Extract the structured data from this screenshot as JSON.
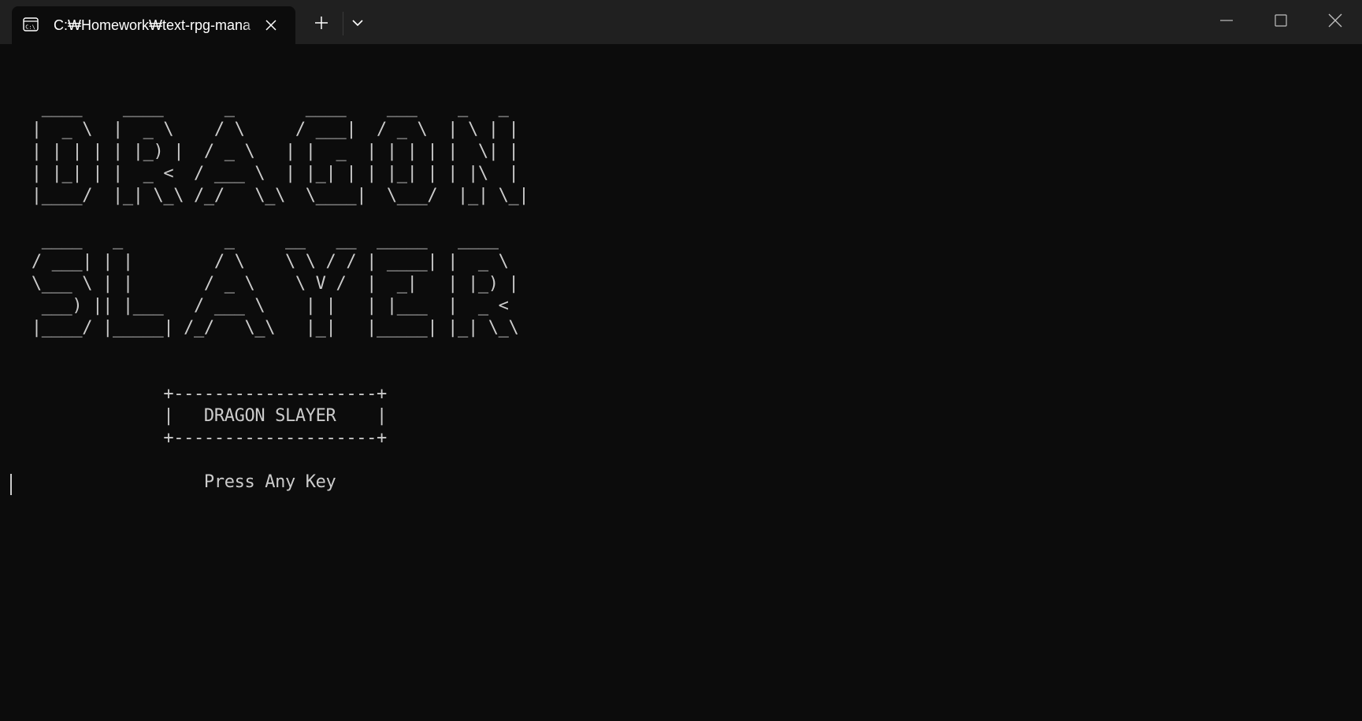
{
  "tab": {
    "title": "C:₩Homework₩text-rpg-mana",
    "icon": "command-prompt-icon"
  },
  "titlebar": {
    "new_tab_icon": "plus-icon",
    "dropdown_icon": "chevron-down-icon",
    "minimize_icon": "minimize-icon",
    "maximize_icon": "maximize-icon",
    "close_icon": "close-icon"
  },
  "terminal": {
    "background": "#0c0c0c",
    "foreground": "#cccccc",
    "lines": [
      "",
      "  ____    ____      _       ____    ___    _   _",
      " |  _ \\  |  _ \\    / \\     / ___|  / _ \\  | \\ | |",
      " | | | | | |_) |  / _ \\   | |  _  | | | | |  \\| |",
      " | |_| | |  _ <  / ___ \\  | |_| | | |_| | | |\\  |",
      " |____/  |_| \\_\\ /_/   \\_\\  \\____|  \\___/  |_| \\_|",
      "",
      "  ____   _          _     __   __  _____   ____",
      " / ___| | |        / \\    \\ \\ / / | ____| |  _ \\",
      " \\___ \\ | |       / _ \\    \\ V /  |  _|   | |_) |",
      "  ___) || |___   / ___ \\    | |   | |___  |  _ <",
      " |____/ |_____| /_/   \\_\\   |_|   |_____| |_| \\_\\",
      "",
      "",
      "              +--------------------+",
      "              |   DRAGON SLAYER    |",
      "              +--------------------+",
      "",
      "                  Press Any Key"
    ]
  }
}
